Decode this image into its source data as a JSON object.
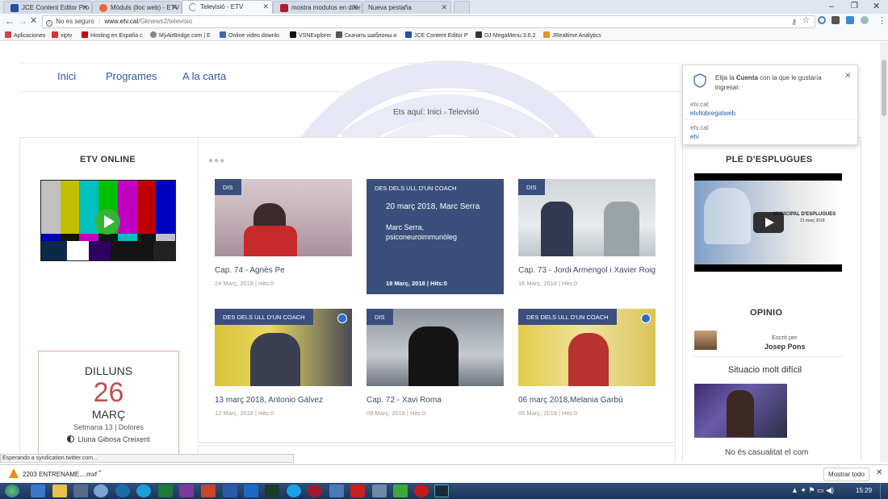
{
  "browser": {
    "tabs": [
      {
        "label": "JCE Content Editor Pro -",
        "icon": "jce-icon",
        "color": "#2a4fa0",
        "active": false
      },
      {
        "label": "Mòduls (lloc web) - ETV",
        "icon": "joomla-icon",
        "color": "#e66a2c",
        "active": false
      },
      {
        "label": "Televisió - ETV",
        "icon": "loading-icon",
        "color": "#9aa6b8",
        "active": true
      },
      {
        "label": "mostra modulos en difer",
        "icon": "weebly-icon",
        "color": "#b01c2e",
        "active": false
      },
      {
        "label": "Nueva pestaña",
        "icon": "",
        "color": "",
        "active": false
      }
    ],
    "security_label": "No es seguro",
    "url_host": "www.etv.cat",
    "url_path": "/Gknews2/televisio",
    "bookmarks": [
      {
        "label": "Aplicaciones",
        "color": "#c44"
      },
      {
        "label": "xiptv",
        "color": "#d33"
      },
      {
        "label": "Hosting en España c",
        "color": "#c00"
      },
      {
        "label": "MyAirBridge.com | E",
        "color": "#888"
      },
      {
        "label": "Online video downlo",
        "color": "#46a"
      },
      {
        "label": "VSNExplorer",
        "color": "#111"
      },
      {
        "label": "Скачать шаблоны и",
        "color": "#555"
      },
      {
        "label": "JCE Content Editor P",
        "color": "#2a4fa0"
      },
      {
        "label": "DJ-MegaMenu 3.6.2",
        "color": "#333"
      },
      {
        "label": "JRealtime Analytics",
        "color": "#d92"
      }
    ]
  },
  "nav": {
    "items": [
      "Inici",
      "Programes",
      "A la carta"
    ]
  },
  "breadcrumb": {
    "prefix": "Ets aquí:",
    "home": "Inici",
    "sep": "›",
    "current": "Televisió"
  },
  "login_popup": {
    "text_pre": "Elija la",
    "text_bold": "Cuenta",
    "text_post": "con la que le gustaría ingresar:",
    "accounts": [
      {
        "site": "etv.cat",
        "user": "etvllobregatweb"
      },
      {
        "site": "etv.cat",
        "user": "etv"
      }
    ]
  },
  "left": {
    "online_title": "ETV ONLINE",
    "calendar": {
      "day": "DILLUNS",
      "date": "26",
      "month": "MARÇ",
      "week": "Setmana 13 | Dolores",
      "moon": "Lluna Gibosa Creixent"
    }
  },
  "grid": {
    "items": [
      {
        "tag": "DIS",
        "title": "Cap. 74 - Agnès Pe",
        "meta": "24 Març, 2018 | Hits:0"
      },
      {
        "tag": "DES DELS ULL D'UN COACH",
        "title": "20 març 2018, Marc Serra",
        "intro": "Marc Serra, psiconeuroimmunòleg",
        "meta": "19 Març, 2018 | Hits:0"
      },
      {
        "tag": "DIS",
        "title": "Cap. 73 - Jordi Armengol i Xavier Roig",
        "meta": "16 Març, 2018 | Hits:0"
      },
      {
        "tag": "DES DELS ULL D'UN COACH",
        "title": "13 març 2018, Antonio Gálvez",
        "meta": "12 Març, 2018 | Hits:0"
      },
      {
        "tag": "DIS",
        "title": "Cap. 72 - Xavi Roma",
        "meta": "09 Març, 2018 | Hits:0"
      },
      {
        "tag": "DES DELS ULL D'UN COACH",
        "title": "06 març 2018,Melania Garbú",
        "meta": "05 Març, 2018 | Hits:0"
      }
    ]
  },
  "right": {
    "ple_title": "PLE D'ESPLUGUES",
    "video_caption": "MUNICIPAL D'ESPLUGUES",
    "video_date": "21 març 2018",
    "opinio_title": "OPINIO",
    "written_by": "Escrit per",
    "author": "Josep Pons",
    "article_title": "Situacio molt difícil",
    "article_teaser": "No és casualitat el com"
  },
  "status_text": "Esperando a syndication.twitter.com...",
  "download": {
    "file": "2203 ENTRENAME....mxf",
    "show_all": "Mostrar todo"
  },
  "taskbar": {
    "time": "15:29"
  }
}
